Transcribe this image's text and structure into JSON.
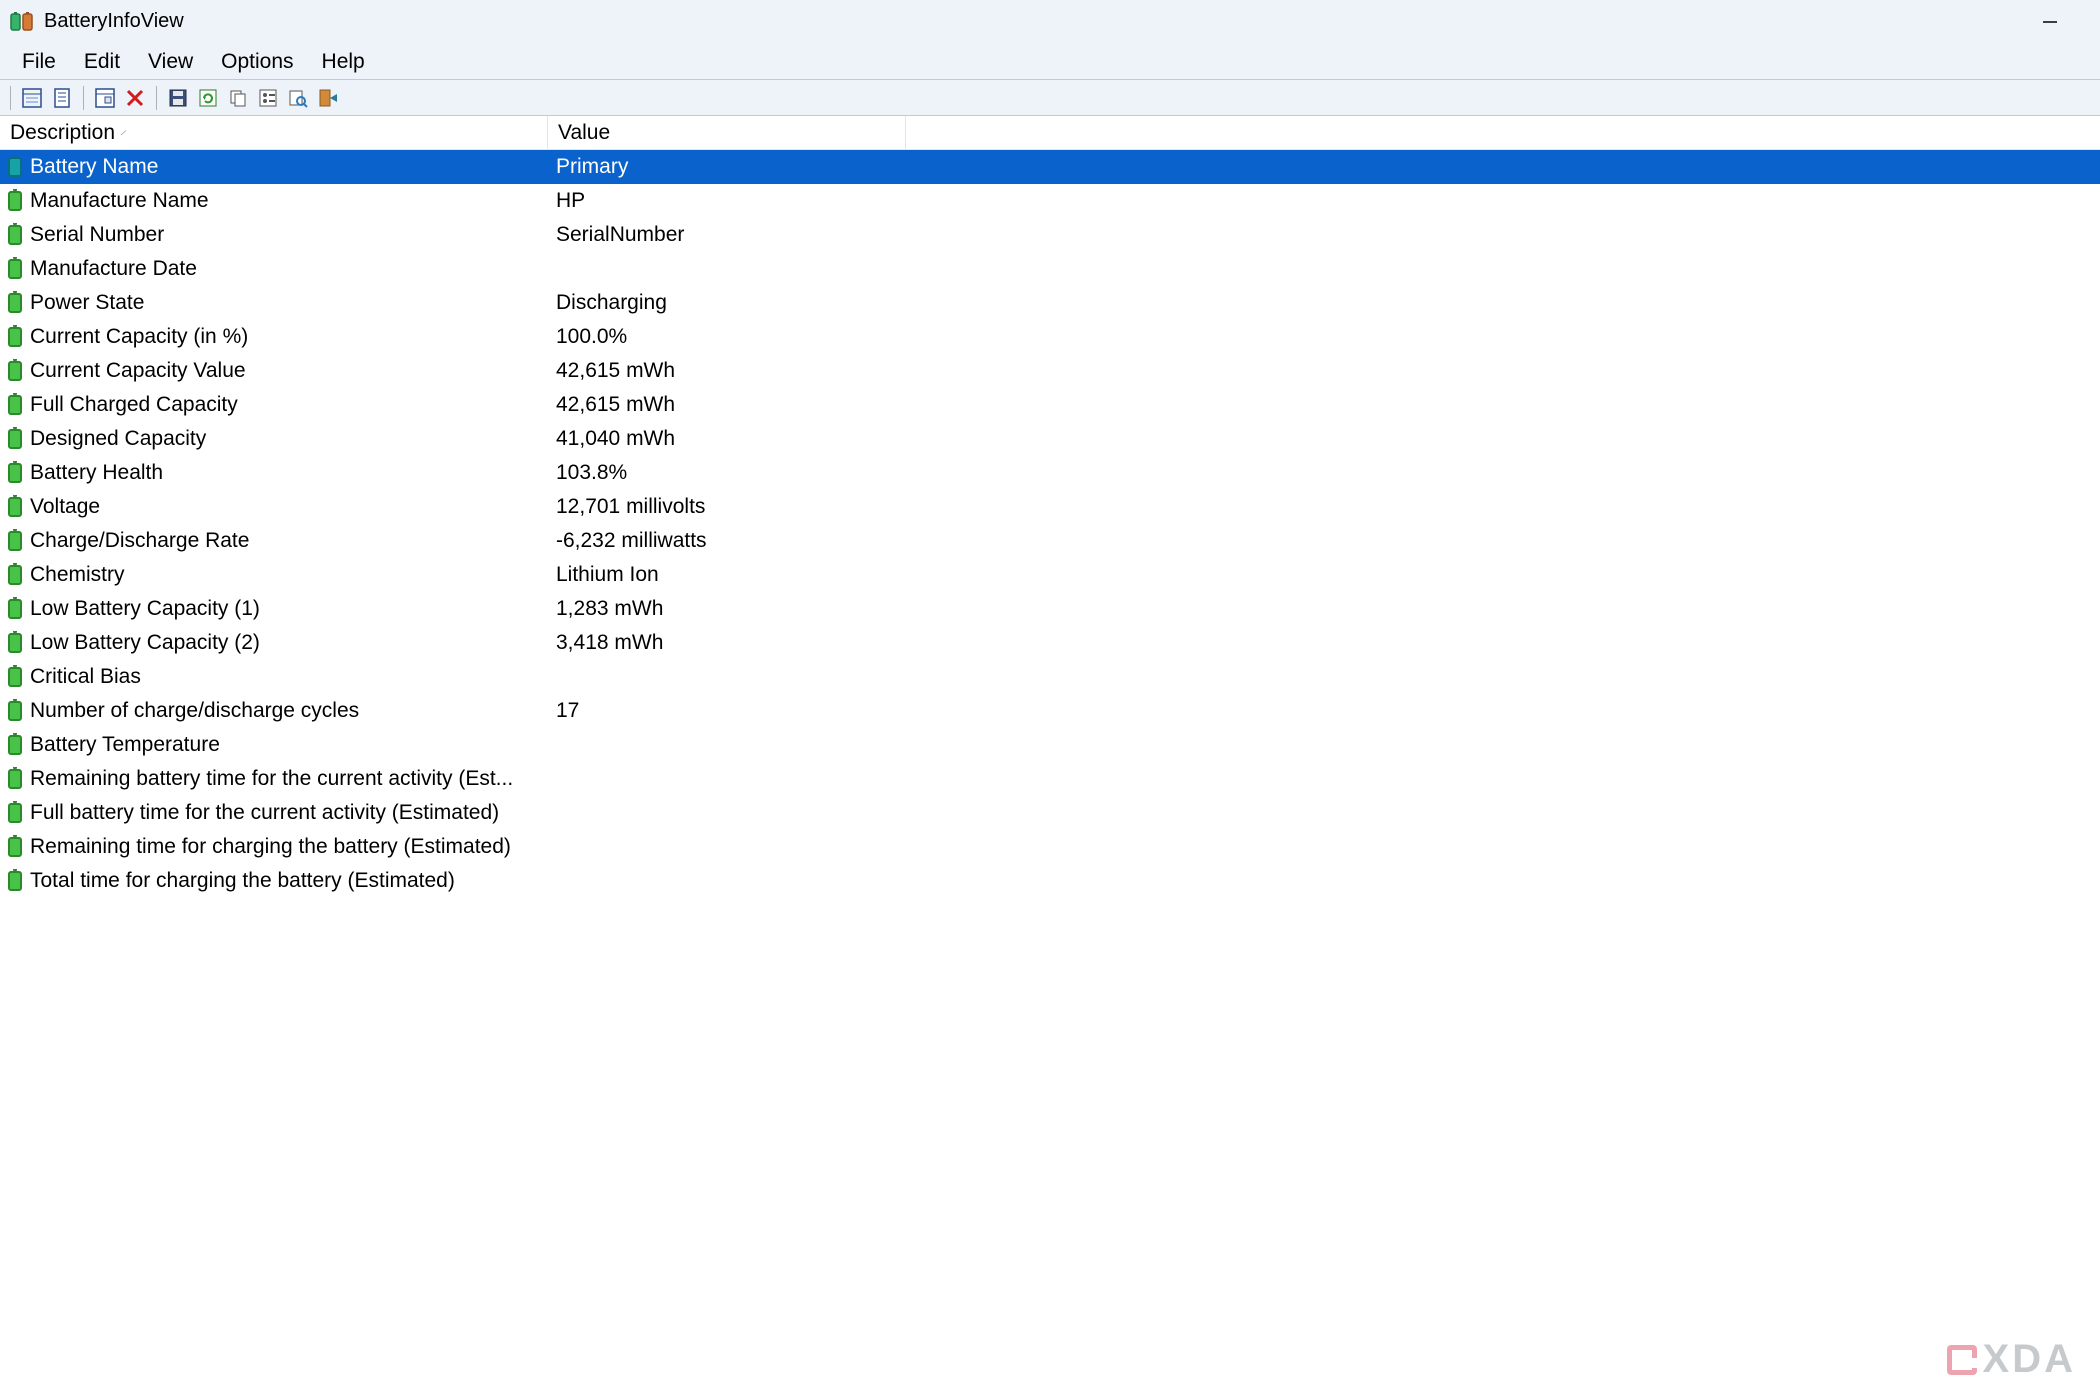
{
  "window": {
    "title": "BatteryInfoView"
  },
  "menubar": {
    "items": [
      "File",
      "Edit",
      "View",
      "Options",
      "Help"
    ]
  },
  "toolbar": {
    "buttons": [
      "details-pane-icon",
      "notes-icon",
      "sep",
      "properties-icon",
      "delete-icon",
      "sep",
      "save-icon",
      "refresh-icon",
      "copy-icon",
      "options-icon",
      "find-icon",
      "exit-icon"
    ]
  },
  "columns": {
    "description": "Description",
    "value": "Value"
  },
  "rows": [
    {
      "desc": "Battery Name",
      "val": "Primary",
      "selected": true
    },
    {
      "desc": "Manufacture Name",
      "val": "HP"
    },
    {
      "desc": "Serial Number",
      "val": "SerialNumber"
    },
    {
      "desc": "Manufacture Date",
      "val": ""
    },
    {
      "desc": "Power State",
      "val": "Discharging"
    },
    {
      "desc": "Current Capacity (in %)",
      "val": "100.0%"
    },
    {
      "desc": "Current Capacity Value",
      "val": "42,615 mWh"
    },
    {
      "desc": "Full Charged Capacity",
      "val": "42,615 mWh"
    },
    {
      "desc": "Designed Capacity",
      "val": "41,040 mWh"
    },
    {
      "desc": "Battery Health",
      "val": "103.8%"
    },
    {
      "desc": "Voltage",
      "val": "12,701 millivolts"
    },
    {
      "desc": "Charge/Discharge Rate",
      "val": "-6,232 milliwatts"
    },
    {
      "desc": "Chemistry",
      "val": "Lithium Ion"
    },
    {
      "desc": "Low Battery Capacity (1)",
      "val": "1,283 mWh"
    },
    {
      "desc": "Low Battery Capacity (2)",
      "val": "3,418 mWh"
    },
    {
      "desc": "Critical Bias",
      "val": ""
    },
    {
      "desc": "Number of charge/discharge cycles",
      "val": "17"
    },
    {
      "desc": "Battery Temperature",
      "val": ""
    },
    {
      "desc": "Remaining battery time for the current activity (Est...",
      "val": ""
    },
    {
      "desc": "Full battery time for the current activity (Estimated)",
      "val": ""
    },
    {
      "desc": "Remaining time for charging the battery (Estimated)",
      "val": ""
    },
    {
      "desc": "Total  time for charging the battery (Estimated)",
      "val": ""
    }
  ],
  "watermark": {
    "text": "XDA"
  }
}
